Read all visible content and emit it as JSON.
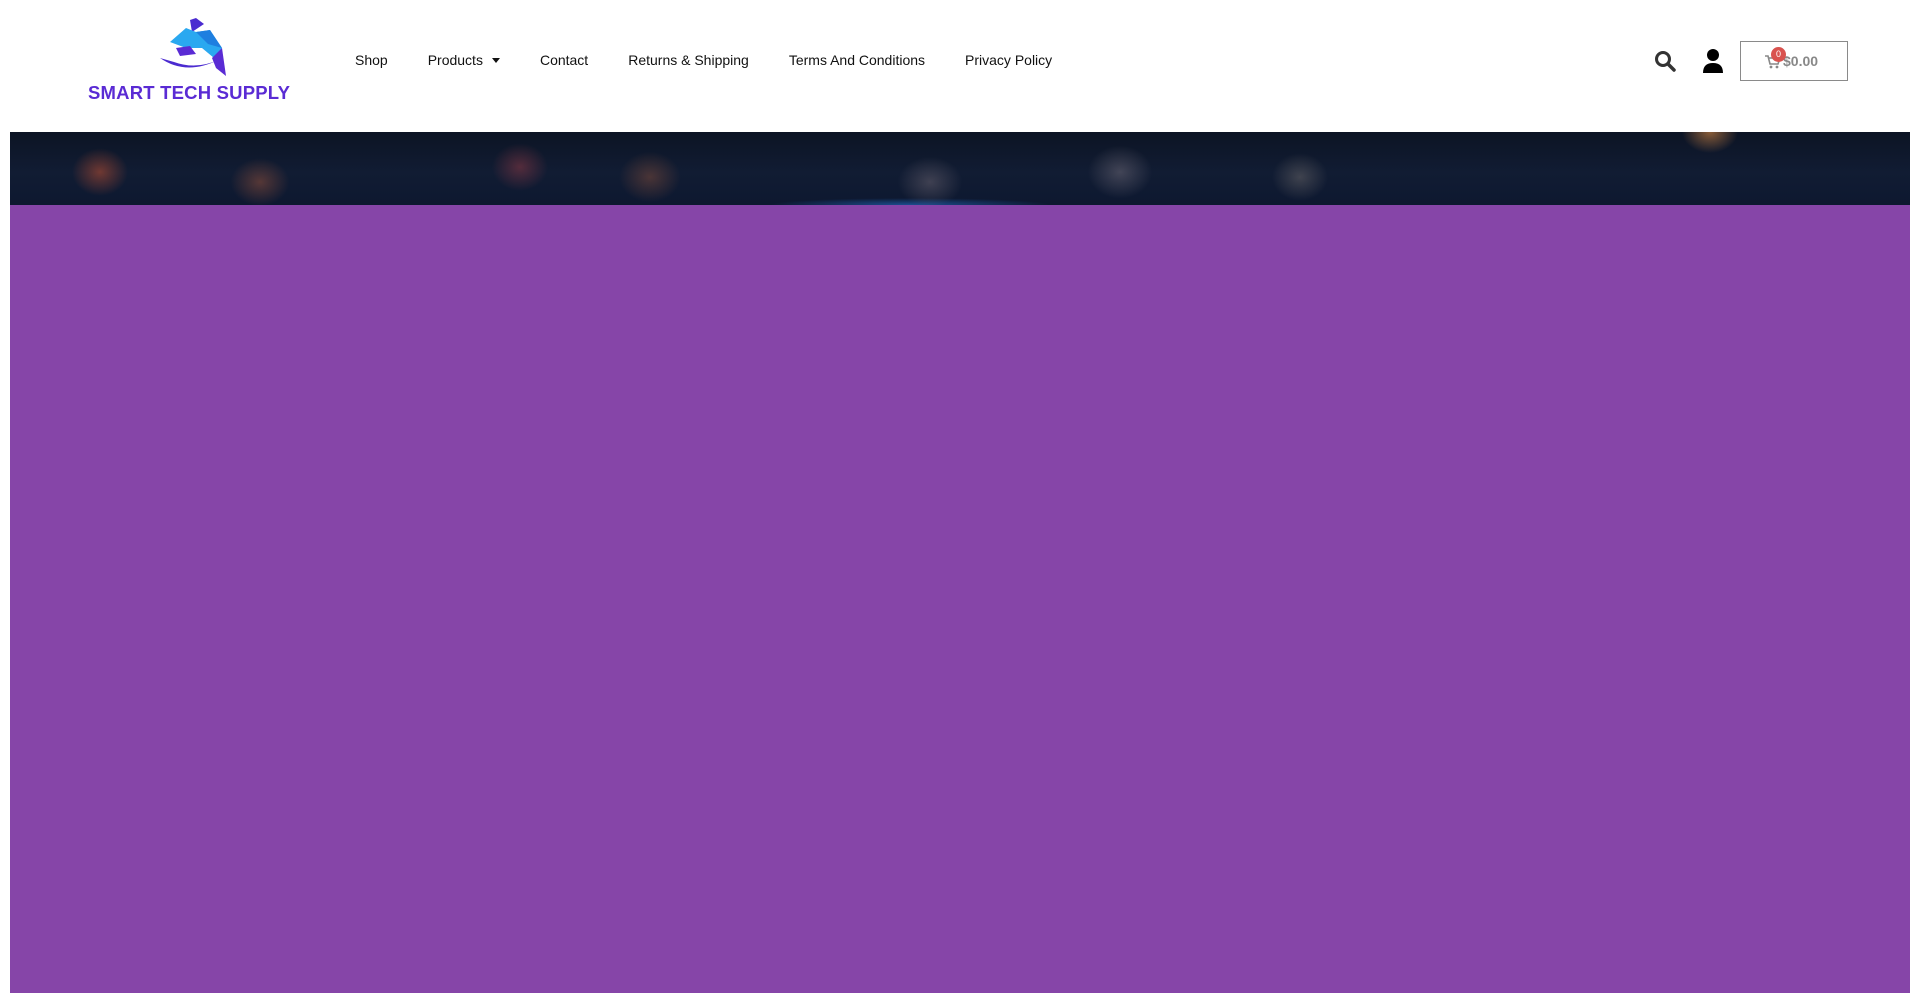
{
  "brand": {
    "name": "SMART TECH SUPPLY",
    "accent_color": "#5a2bd4",
    "panel_color": "#8645a8"
  },
  "nav": {
    "items": [
      {
        "label": "Shop",
        "has_dropdown": false
      },
      {
        "label": "Products",
        "has_dropdown": true
      },
      {
        "label": "Contact",
        "has_dropdown": false
      },
      {
        "label": "Returns & Shipping",
        "has_dropdown": false
      },
      {
        "label": "Terms And Conditions",
        "has_dropdown": false
      },
      {
        "label": "Privacy Policy",
        "has_dropdown": false
      }
    ]
  },
  "header_icons": {
    "search": "search-icon",
    "account": "user-icon",
    "cart": "cart-icon"
  },
  "cart": {
    "total": "$0.00",
    "count": "0"
  }
}
